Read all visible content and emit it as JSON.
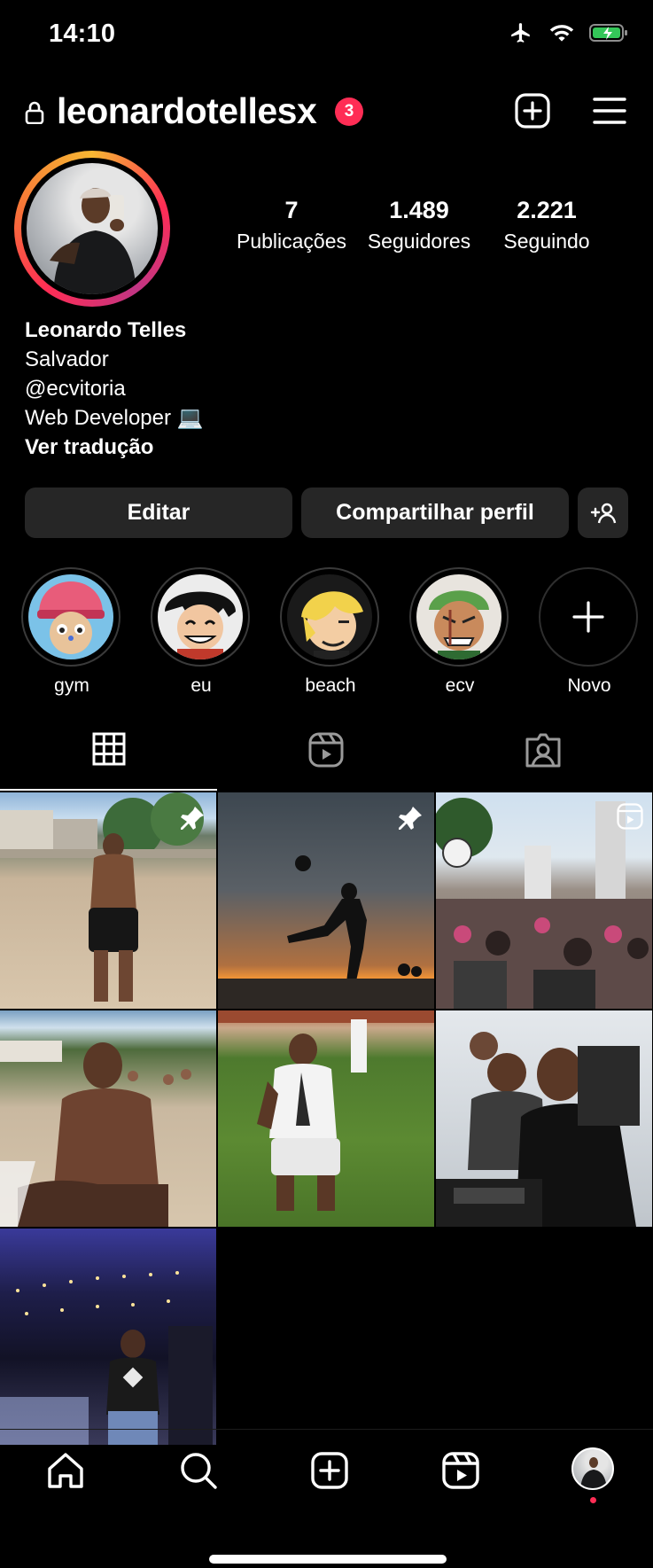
{
  "status_bar": {
    "time": "14:10"
  },
  "header": {
    "username": "leonardotellesx",
    "notification_count": "3"
  },
  "stats": [
    {
      "value": "7",
      "label": "Publicações"
    },
    {
      "value": "1.489",
      "label": "Seguidores"
    },
    {
      "value": "2.221",
      "label": "Seguindo"
    }
  ],
  "bio": {
    "name": "Leonardo Telles",
    "line1": "Salvador",
    "line2": "@ecvitoria",
    "line3": "Web Developer 💻",
    "translate": "Ver tradução"
  },
  "buttons": {
    "edit": "Editar",
    "share": "Compartilhar perfil"
  },
  "highlights": [
    {
      "label": "gym",
      "color": "#c0392b"
    },
    {
      "label": "eu",
      "color": "#111111"
    },
    {
      "label": "beach",
      "color": "#e8c34a"
    },
    {
      "label": "ecv",
      "color": "#5aa04a"
    },
    {
      "label": "Novo"
    }
  ],
  "icons": [
    "lock-icon",
    "plus-square-icon",
    "menu-icon",
    "grid-icon",
    "reels-icon",
    "tagged-icon",
    "home-icon",
    "search-icon",
    "create-icon",
    "reels-nav-icon",
    "profile-avatar-icon",
    "pin-icon"
  ],
  "colors": {
    "badge": "#ff2d55",
    "button_bg": "#262626",
    "accent": "#ff2d55"
  }
}
